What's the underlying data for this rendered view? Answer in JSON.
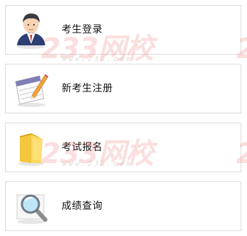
{
  "menu": {
    "items": [
      {
        "label": "考生登录",
        "icon": "user-avatar-icon"
      },
      {
        "label": "新考生注册",
        "icon": "notepad-pencil-icon"
      },
      {
        "label": "考试报名",
        "icon": "folder-icon"
      },
      {
        "label": "成绩查询",
        "icon": "magnifier-icon"
      }
    ]
  },
  "watermark": {
    "brand": "233网校",
    "url": "www.233.com",
    "color": "#eb6969"
  }
}
